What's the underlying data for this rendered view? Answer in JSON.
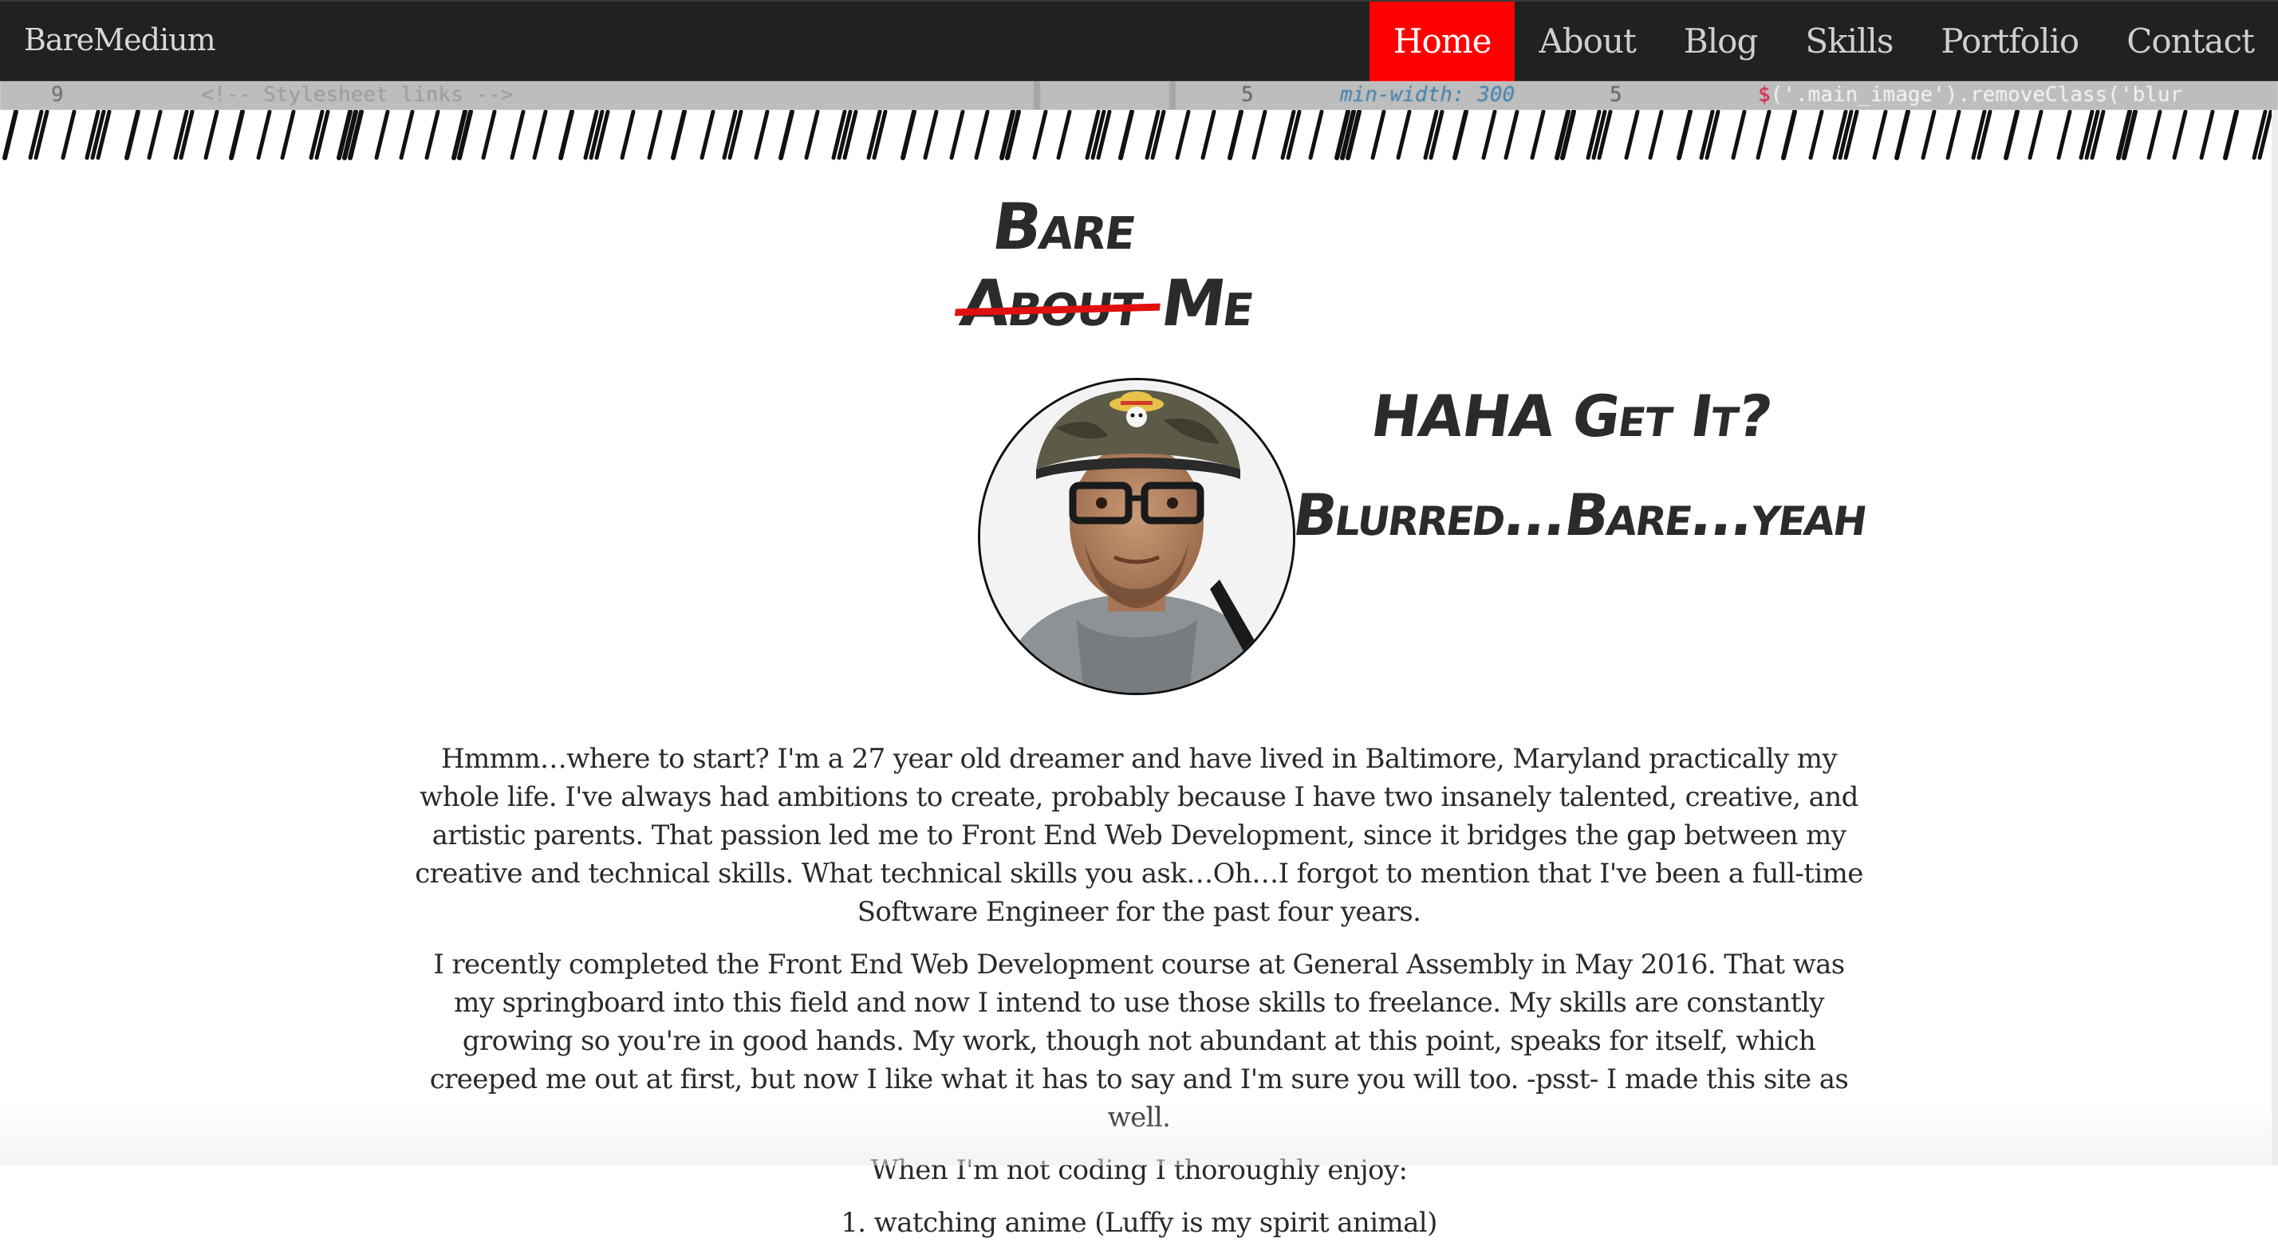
{
  "nav": {
    "brand": "BareMedium",
    "items": [
      {
        "label": "Home",
        "active": true
      },
      {
        "label": "About",
        "active": false
      },
      {
        "label": "Blog",
        "active": false
      },
      {
        "label": "Skills",
        "active": false
      },
      {
        "label": "Portfolio",
        "active": false
      },
      {
        "label": "Contact",
        "active": false
      }
    ],
    "active_color": "#ff0000"
  },
  "code_strip": {
    "line1_number": "9",
    "line1_text": "<!-- Stylesheet links -->",
    "line2_number": "5",
    "line2_text": "min-width: 300",
    "line3_number": "5",
    "line3_prefix": "$",
    "line3_text": "('.main_image').removeClass('blur"
  },
  "heading": {
    "bare": "Bare",
    "struck": "About",
    "me": "Me",
    "strike_color": "#e01010"
  },
  "tagline": {
    "line1": "HAHA Get It?",
    "line2": "Blurred...Bare...yeah"
  },
  "content": {
    "p1": "Hmmm…where to start? I'm a 27 year old dreamer and have lived in Baltimore, Maryland practically my whole life. I've always had ambitions to create, probably because I have two insanely talented, creative, and artistic parents. That passion led me to Front End Web Development, since it bridges the gap between my creative and technical skills. What technical skills you ask…Oh…I forgot to mention that I've been a full-time Software Engineer for the past four years.",
    "p2": "I recently completed the Front End Web Development course at General Assembly in May 2016. That was my springboard into this field and now I intend to use those skills to freelance. My skills are constantly growing so you're in good hands. My work, though not abundant at this point, speaks for itself, which creeped me out at first, but now I like what it has to say and I'm sure you will too. -psst- I made this site as well.",
    "enjoy": "When I'm not coding I thoroughly enjoy:",
    "list_item_1": "1. watching anime (Luffy is my spirit animal)"
  }
}
